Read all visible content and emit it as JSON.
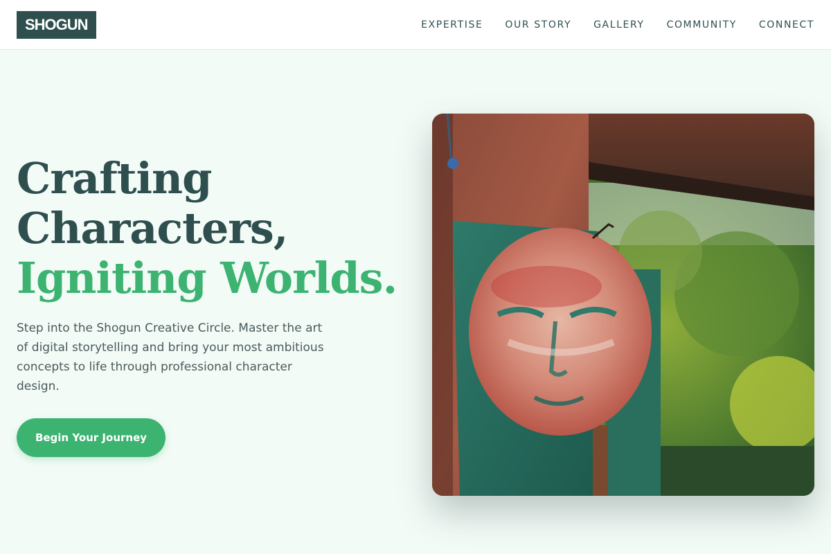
{
  "brand": {
    "logo": "SHOGUN"
  },
  "nav": {
    "items": [
      {
        "label": "EXPERTISE"
      },
      {
        "label": "OUR STORY"
      },
      {
        "label": "GALLERY"
      },
      {
        "label": "COMMUNITY"
      },
      {
        "label": "CONNECT"
      }
    ]
  },
  "hero": {
    "headline": {
      "line1": "Crafting",
      "line2": "Characters,",
      "line3": "Igniting Worlds."
    },
    "description": "Step into the Shogun Creative Circle. Master the art of digital storytelling and bring your most ambitious concepts to life through professional character design.",
    "cta_label": "Begin Your Journey",
    "image": {
      "subject": "painted-face-artwork-photo"
    }
  },
  "colors": {
    "primary": "#2f4f4f",
    "accent": "#3cb371",
    "background": "#f3fbf7"
  }
}
